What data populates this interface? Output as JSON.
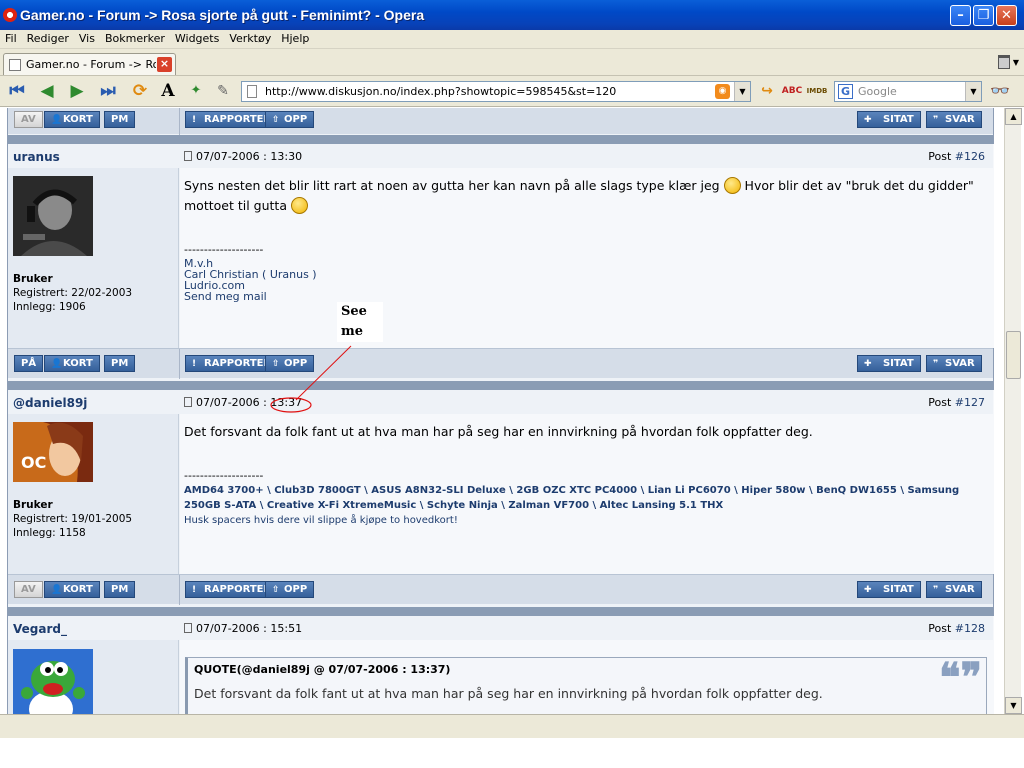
{
  "window": {
    "title": "Gamer.no - Forum -> Rosa sjorte på gutt - Feminimt? - Opera"
  },
  "menu": [
    "Fil",
    "Rediger",
    "Vis",
    "Bokmerker",
    "Widgets",
    "Verktøy",
    "Hjelp"
  ],
  "tab": {
    "label": "Gamer.no - Forum -> Ro...",
    "close": "×"
  },
  "address": {
    "url": "http://www.diskusjon.no/index.php?showtopic=598545&st=120"
  },
  "search": {
    "placeholder": "Google"
  },
  "buttons": {
    "av": "AV",
    "pa": "PÅ",
    "kort": "KORT",
    "pm": "PM",
    "rapporter": "RAPPORTER",
    "opp": "OPP",
    "sitat": "SITAT",
    "svar": "SVAR"
  },
  "posts": [
    {
      "username": "uranus",
      "date": "07/07-2006 : 13:30",
      "post_label": "Post ",
      "post_num": "#126",
      "role": "Bruker",
      "registered": "Registrert: 22/02-2003",
      "posts_count": "Innlegg: 1906",
      "body_1": "Syns nesten det blir litt rart at noen av gutta her kan navn på alle slags type klær jeg",
      "body_2": "Hvor blir det av \"bruk det du gidder\"",
      "body_3": "mottoet til gutta",
      "sig_divider": "--------------------",
      "sig_lines": [
        "M.v.h",
        "Carl Christian ( Uranus )",
        "Ludrio.com",
        "Send meg mail"
      ]
    },
    {
      "username": "@daniel89j",
      "date_prefix": "07/07-2006 :",
      "date_time": "13:37",
      "post_label": "Post ",
      "post_num": "#127",
      "role": "Bruker",
      "registered": "Registrert: 19/01-2005",
      "posts_count": "Innlegg: 1158",
      "body_1": "Det forsvant da folk fant ut at hva man har på seg har en innvirkning på hvordan folk oppfatter deg.",
      "sig_divider": "--------------------",
      "sig_specs": "AMD64 3700+ \\ Club3D 7800GT \\ ASUS A8N32-SLI Deluxe \\ 2GB OZC XTC PC4000 \\ Lian Li PC6070 \\ Hiper 580w \\ BenQ DW1655 \\ Samsung 250GB S-ATA \\ Creative X-Fi XtremeMusic \\ Schyte Ninja \\ Zalman VF700 \\ Altec Lansing 5.1 THX",
      "sig_note": "Husk spacers hvis dere vil slippe å kjøpe to hovedkort!"
    },
    {
      "username": "Vegard_",
      "date": "07/07-2006 : 15:51",
      "post_label": "Post ",
      "post_num": "#128",
      "quote_header": "QUOTE(@daniel89j @ 07/07-2006 : 13:37)",
      "quote_text": "Det forsvant da folk fant ut at hva man har på seg har en innvirkning på hvordan folk oppfatter deg."
    }
  ],
  "annotation": {
    "line1": "See",
    "line2": "me"
  },
  "colors": {
    "accent": "#1d3c6e",
    "annotation": "#e01010",
    "separator": "#8a9cb4"
  }
}
